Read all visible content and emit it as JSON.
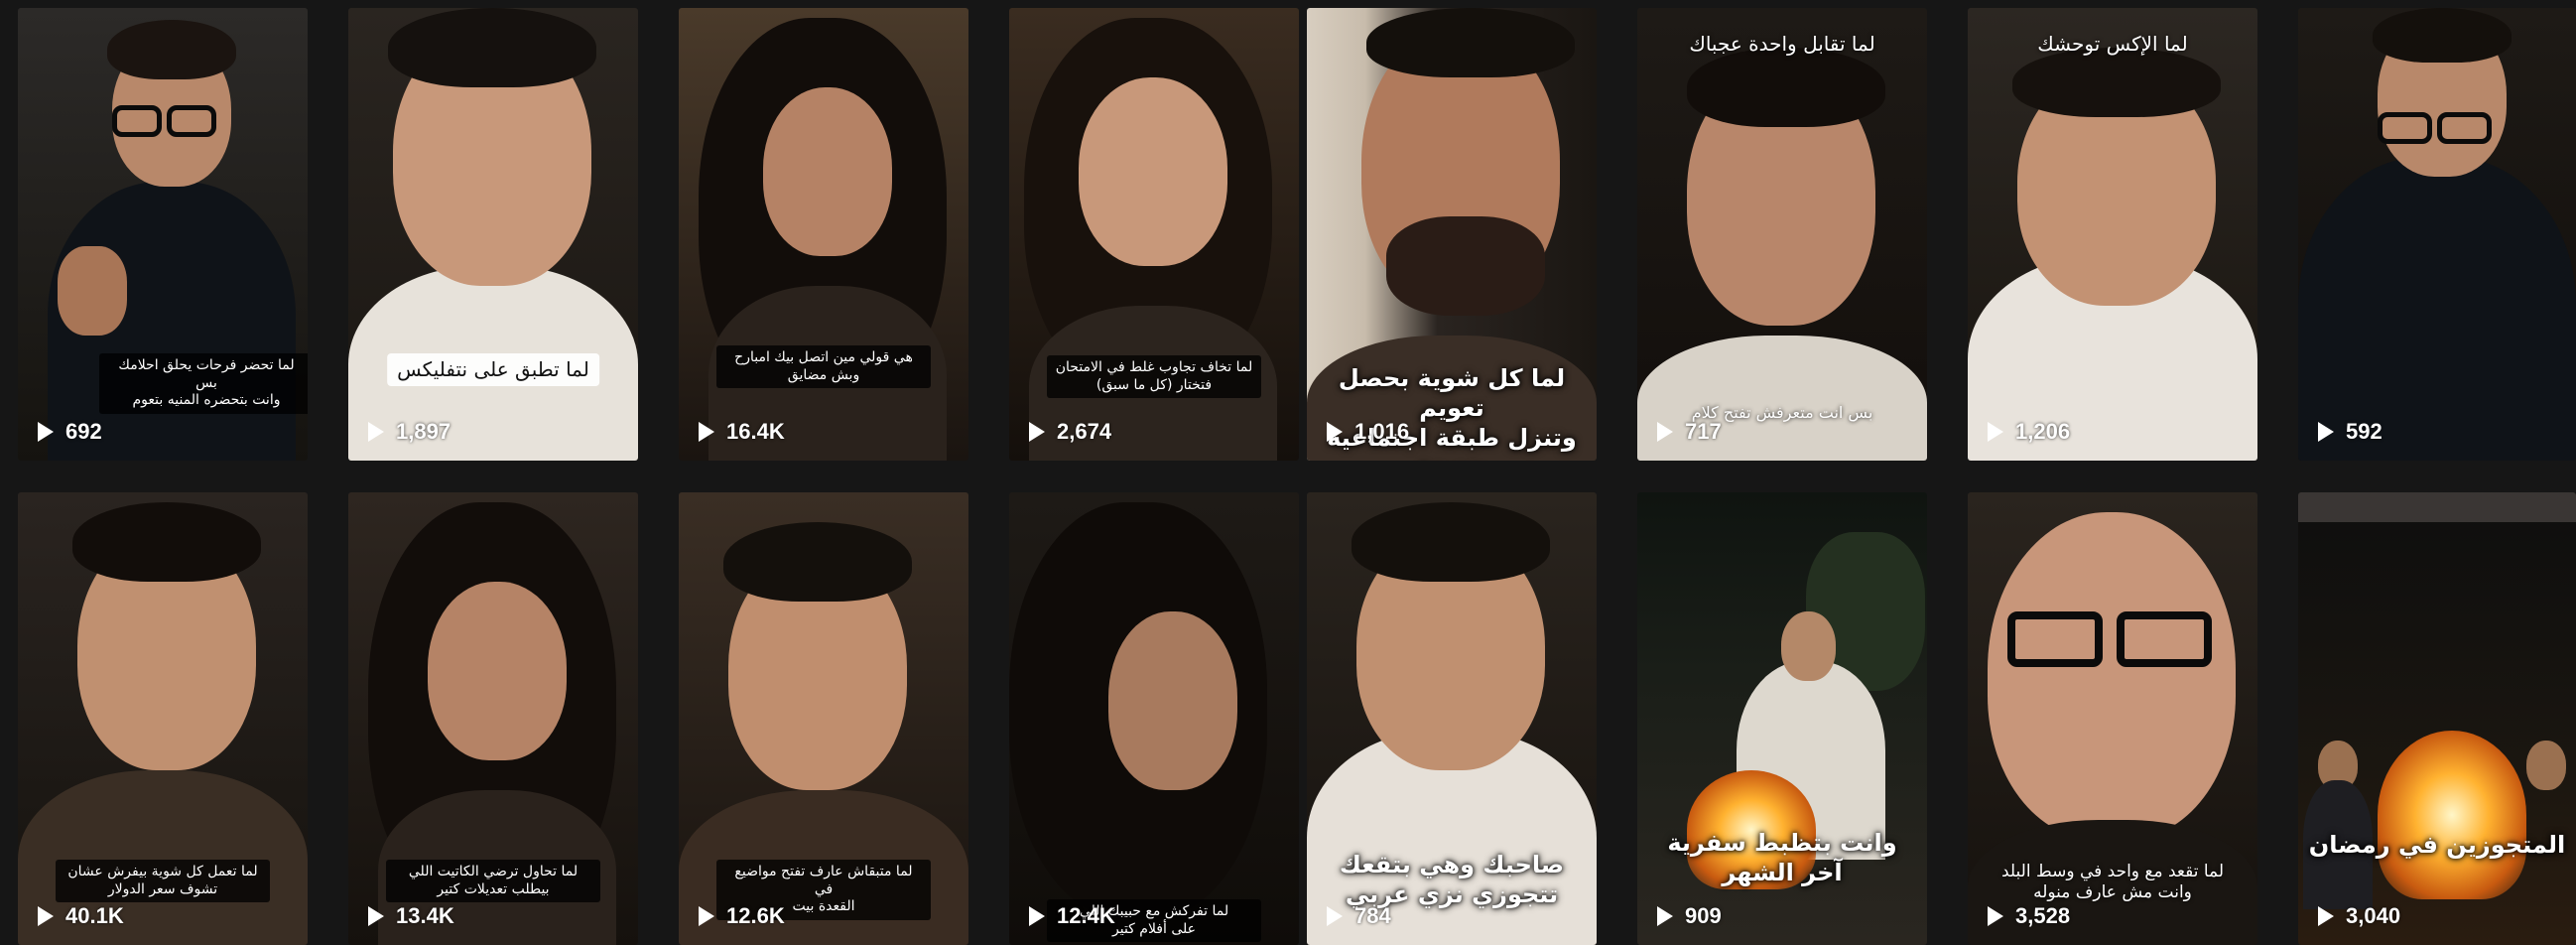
{
  "tiles": [
    {
      "views": "692",
      "caption": "لما تحضر فرحات يحلق احلامك بس\nوانت بتحضره المنيه بتعوم",
      "caption_style": "small"
    },
    {
      "views": "1,897",
      "caption": "لما تطبق على نتفليكس",
      "caption_style": "boxw"
    },
    {
      "views": "16.4K",
      "caption": "هي قولي مين اتصل بيك امبارح\nوبش مضايق",
      "caption_style": "small"
    },
    {
      "views": "2,674",
      "caption": "لما تخاف تجاوب غلط في الامتحان\nفتختار (كل ما سبق)",
      "caption_style": "small"
    },
    {
      "views": "1,016",
      "caption": "لما كل شوية بحصل تعويم\nوتنزل طبقة اجتماعية جديدة",
      "caption_style": "big"
    },
    {
      "views": "717",
      "caption": "لما تقابل واحدة عجباك",
      "caption_style": "top",
      "caption2": "بس انت متعرفش تفتح كلام"
    },
    {
      "views": "1,206",
      "caption": "لما الإكس توحشك",
      "caption_style": "top"
    },
    {
      "views": "592",
      "caption": "",
      "caption_style": "none"
    },
    {
      "views": "40.1K",
      "caption": "لما تعمل كل شوية بيفرش عشان\nتشوف سعر الدولار",
      "caption_style": "small"
    },
    {
      "views": "13.4K",
      "caption": "لما تحاول ترضي الكاتيت اللي\nبيطلب تعديلات كتير",
      "caption_style": "small"
    },
    {
      "views": "12.6K",
      "caption": "لما متبقاش عارف تفتح مواضيع في\nالقعدة بيت",
      "caption_style": "small"
    },
    {
      "views": "12.4K",
      "caption": "لما تفركش مع حبيبك اللي\nعلى أفلام كتير",
      "caption_style": "small"
    },
    {
      "views": "784",
      "caption": "صاحبك وهي بتقعك\nتتجوزي نزي عربي",
      "caption_style": "big"
    },
    {
      "views": "909",
      "caption": "وانت بتظبط سفرية\nآخر الشهر",
      "caption_style": "big"
    },
    {
      "views": "3,528",
      "caption": "لما تقعد مع واحد في وسط البلد\nوانت مش عارف منوله",
      "caption_style": "smallplain"
    },
    {
      "views": "3,040",
      "caption": "المتجوزين في رمضان",
      "caption_style": "big"
    }
  ],
  "colors": {
    "page_bg": "#161616",
    "text": "#ffffff"
  },
  "icons": {
    "views": "play-icon"
  }
}
